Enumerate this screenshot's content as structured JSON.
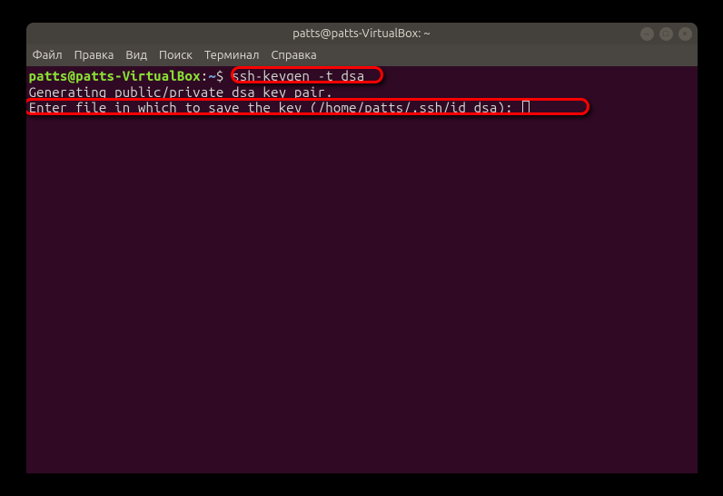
{
  "window": {
    "title": "patts@patts-VirtualBox: ~"
  },
  "menu": {
    "items": [
      "Файл",
      "Правка",
      "Вид",
      "Поиск",
      "Терминал",
      "Справка"
    ]
  },
  "terminal": {
    "prompt_userhost": "patts@patts-VirtualBox",
    "prompt_colon": ":",
    "prompt_path": "~",
    "prompt_dollar": "$ ",
    "command": "ssh-keygen -t dsa",
    "line2": "Generating public/private dsa key pair.",
    "line3": "Enter file in which to save the key (/home/patts/.ssh/id_dsa): "
  },
  "controls": {
    "min": "–",
    "max": "□",
    "close": "×"
  }
}
